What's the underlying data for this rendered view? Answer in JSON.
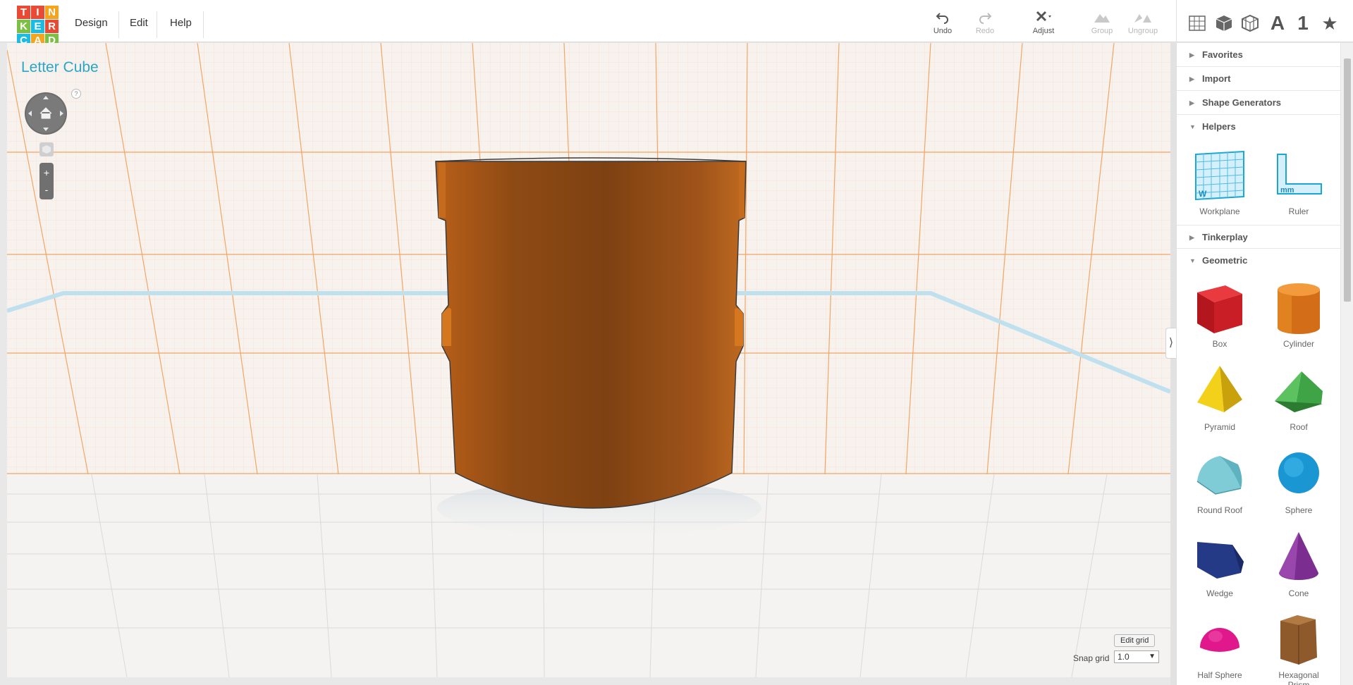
{
  "logo": {
    "letters": [
      "T",
      "I",
      "N",
      "K",
      "E",
      "R",
      "C",
      "A",
      "D"
    ],
    "colors": [
      "#e94a34",
      "#e94a34",
      "#f6a41b",
      "#7ac143",
      "#1abce4",
      "#e94a34",
      "#1abce4",
      "#f6a41b",
      "#7ac143"
    ]
  },
  "menu": {
    "design": "Design",
    "edit": "Edit",
    "help": "Help"
  },
  "toolbar": {
    "undo": "Undo",
    "redo": "Redo",
    "adjust": "Adjust",
    "group": "Group",
    "ungroup": "Ungroup"
  },
  "design_title": "Letter Cube",
  "navigation": {
    "help": "?",
    "zoom_in": "+",
    "zoom_out": "-"
  },
  "grid": {
    "edit_grid": "Edit grid",
    "snap_label": "Snap grid",
    "snap_value": "1.0",
    "arrow": "▼"
  },
  "panel_toggle": "⟩",
  "sidebar": {
    "categories": {
      "favorites": "Favorites",
      "import": "Import",
      "shape_generators": "Shape Generators",
      "helpers": "Helpers",
      "tinkerplay": "Tinkerplay",
      "geometric": "Geometric"
    },
    "helpers": {
      "workplane": "Workplane",
      "ruler": "Ruler"
    },
    "shapes": {
      "box": "Box",
      "cylinder": "Cylinder",
      "pyramid": "Pyramid",
      "roof": "Roof",
      "round_roof": "Round Roof",
      "sphere": "Sphere",
      "wedge": "Wedge",
      "cone": "Cone",
      "half_sphere": "Half Sphere",
      "hexagonal_prism": "Hexagonal Prism"
    }
  },
  "view_icons": {
    "letter": "A",
    "number": "1",
    "star": "★"
  },
  "colors": {
    "accent": "#29a6c9",
    "object": "#c8691e",
    "grid_major": "#f1a35d",
    "grid_minor": "#f3dccb"
  }
}
